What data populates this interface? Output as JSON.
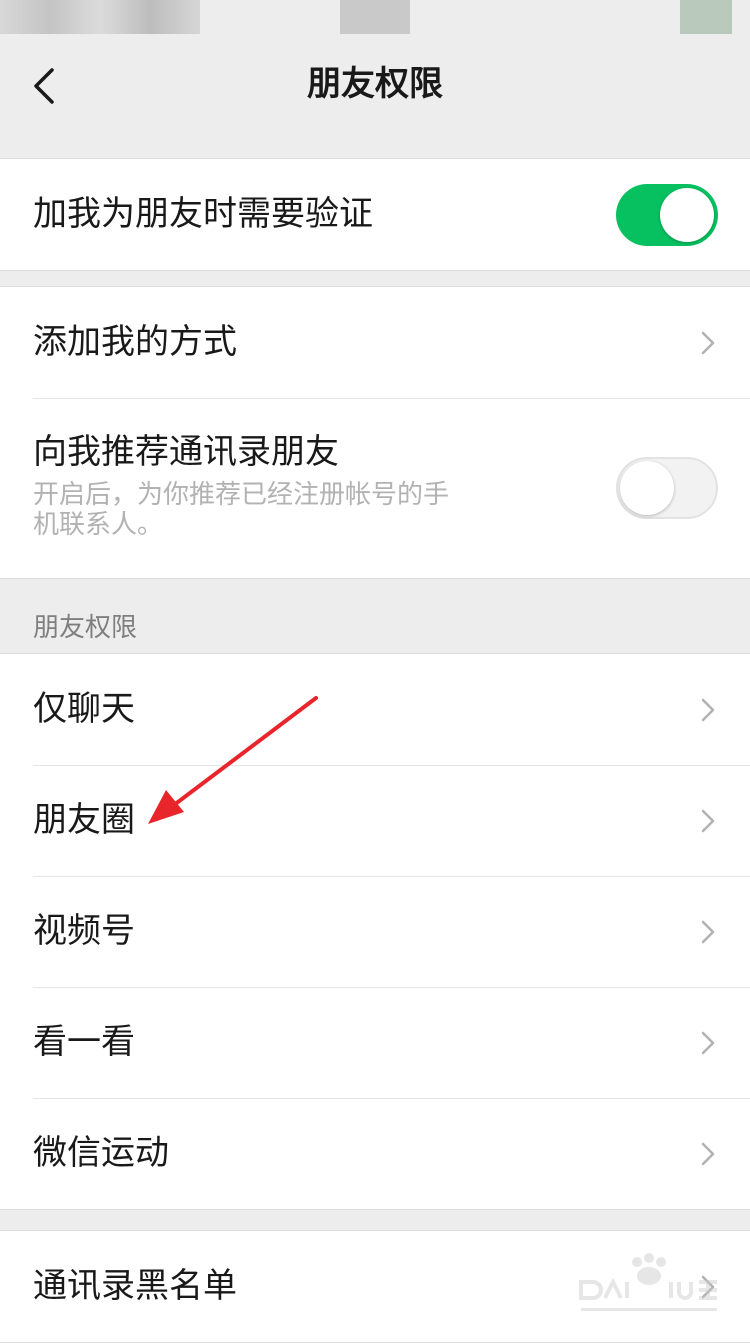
{
  "nav": {
    "title": "朋友权限",
    "back_icon": "chevron-left-icon"
  },
  "verify": {
    "label": "加我为朋友时需要验证",
    "toggle_on": true
  },
  "add_methods": {
    "label": "添加我的方式"
  },
  "recommend": {
    "label": "向我推荐通讯录朋友",
    "description": "开启后，为你推荐已经注册帐号的手机联系人。",
    "toggle_on": false
  },
  "friend_permissions": {
    "header": "朋友权限",
    "items": [
      {
        "label": "仅聊天"
      },
      {
        "label": "朋友圈"
      },
      {
        "label": "视频号"
      },
      {
        "label": "看一看"
      },
      {
        "label": "微信运动"
      }
    ]
  },
  "blacklist": {
    "label": "通讯录黑名单"
  },
  "colors": {
    "toggle_on": "#07c160",
    "background": "#ededed",
    "annotation_arrow": "#e8252a"
  }
}
